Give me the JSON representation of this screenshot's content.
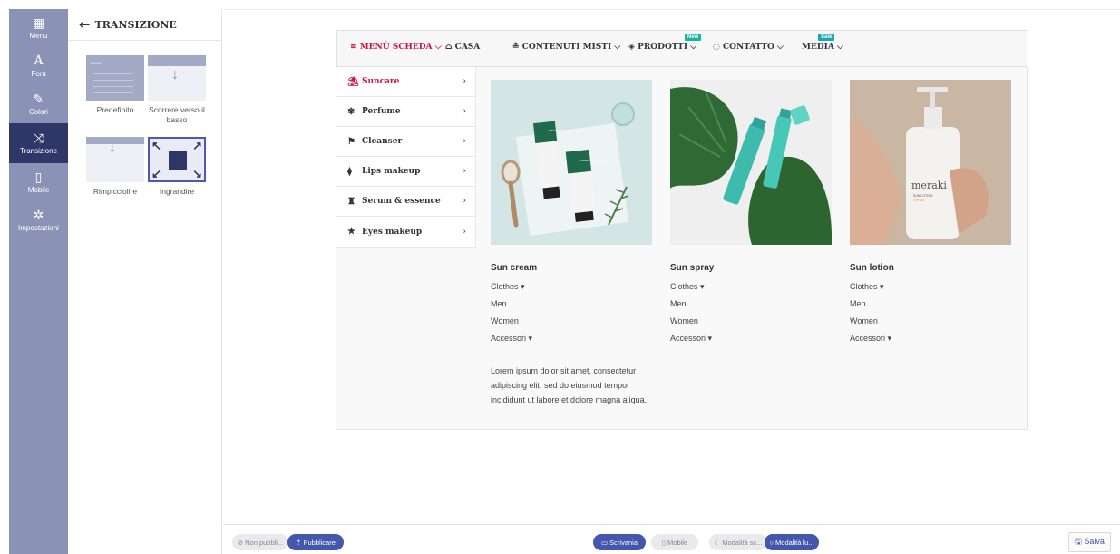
{
  "rail": [
    {
      "icon": "grid-icon",
      "glyph": "▦",
      "label": "Menu"
    },
    {
      "icon": "font-icon",
      "glyph": "A",
      "label": "Font"
    },
    {
      "icon": "brush-icon",
      "glyph": "✎",
      "label": "Colori"
    },
    {
      "icon": "shuffle-icon",
      "glyph": "⤨",
      "label": "Transizione"
    },
    {
      "icon": "mobile-icon",
      "glyph": "▯",
      "label": "Mobile"
    },
    {
      "icon": "gear-icon",
      "glyph": "✲",
      "label": "Impostazioni"
    }
  ],
  "panel": {
    "title": "TRANSIZIONE",
    "back_glyph": "←",
    "thumb_menu_label": "MENU",
    "options": [
      {
        "label": "Predefinito"
      },
      {
        "label": "Scorrere verso il basso"
      },
      {
        "label": "Rimpicciolire"
      },
      {
        "label": "Ingrandire"
      }
    ]
  },
  "menubar": {
    "items": [
      {
        "icon": "hamburger-icon",
        "glyph": "≡",
        "label": "MENÙ SCHEDA",
        "caret": "⌵"
      },
      {
        "icon": "home-icon",
        "glyph": "⌂",
        "label": "CASA",
        "caret": ""
      },
      {
        "icon": "stack-icon",
        "glyph": "≛",
        "label": "CONTENUTI MISTI",
        "caret": "⌵"
      },
      {
        "icon": "diamond-icon",
        "glyph": "◈",
        "label": "PRODOTTI",
        "caret": "⌵"
      },
      {
        "icon": "chat-icon",
        "glyph": "◌",
        "label": "CONTATTO",
        "caret": "⌵"
      },
      {
        "icon": "",
        "glyph": "",
        "label": "MEDIA",
        "caret": "⌵"
      }
    ],
    "badges": {
      "new": "New",
      "sale": "Sale"
    },
    "colors": {
      "active": "#d2143a",
      "new_badge": "#19b4a8",
      "sale_badge": "#19a7b8"
    }
  },
  "submenu": [
    {
      "icon": "umbrella-icon",
      "glyph": "⛱",
      "label": "Suncare",
      "chevron": "›"
    },
    {
      "icon": "snowflake-icon",
      "glyph": "❄",
      "label": "Perfume",
      "chevron": "›"
    },
    {
      "icon": "flag-icon",
      "glyph": "⚑",
      "label": "Cleanser",
      "chevron": "›"
    },
    {
      "icon": "lipstick-icon",
      "glyph": "⧫",
      "label": "Lips makeup",
      "chevron": "›"
    },
    {
      "icon": "bottle-icon",
      "glyph": "♜",
      "label": "Serum & essence",
      "chevron": "›"
    },
    {
      "icon": "star-icon",
      "glyph": "★",
      "label": "Eyes makeup",
      "chevron": "›"
    }
  ],
  "products": [
    {
      "title": "Sun cream",
      "links": [
        "Clothes ▾",
        "Men",
        "Women",
        "Accessori ▾"
      ],
      "image_icon": "sun-cream-image"
    },
    {
      "title": "Sun spray",
      "links": [
        "Clothes ▾",
        "Men",
        "Women",
        "Accessori ▾"
      ],
      "image_icon": "sun-spray-image"
    },
    {
      "title": "Sun lotion",
      "links": [
        "Clothes ▾",
        "Men",
        "Women",
        "Accessori ▾"
      ],
      "image_icon": "sun-lotion-image"
    }
  ],
  "product_images": {
    "cream_tube_text": "TRUECICA MINERAL 100",
    "lotion_brand": "meraki",
    "lotion_sub": "SUN LOTION",
    "lotion_spf": "SPF30"
  },
  "description": "Lorem ipsum dolor sit amet, consectetur adipiscing elit, sed do eiusmod tempor incididunt ut labore et dolore magna aliqua.",
  "bottombar": {
    "unpublished": "⊘ Non pubbli...",
    "publish": "⇡ Pubblicare",
    "desktop": "▭ Scrivania",
    "mobile": "▯ Mobile",
    "dark_mode": "☾ Modalità sc...",
    "light_mode": "○ Modalità lu...",
    "save": "🖫 Salva"
  },
  "colors": {
    "rail_bg": "#8a93b5",
    "rail_active": "#2f3768",
    "accent": "#4556ad"
  }
}
